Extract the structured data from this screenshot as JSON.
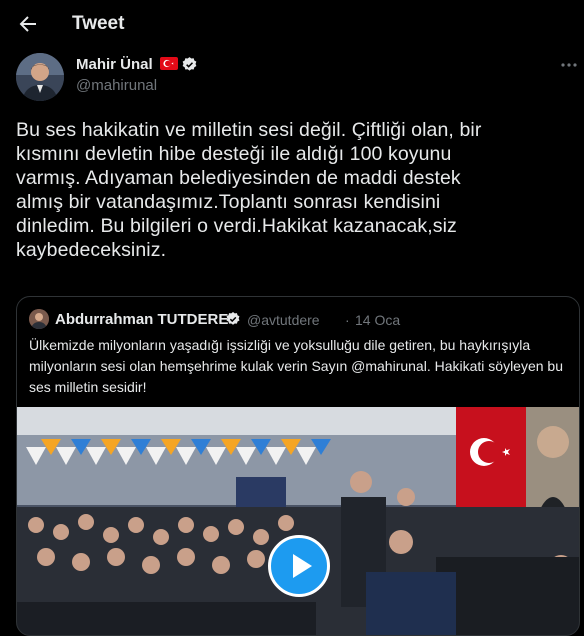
{
  "header": {
    "title": "Tweet",
    "back_icon": "arrow-left-icon"
  },
  "tweet": {
    "author_name": "Mahir Ünal",
    "handle": "@mahirunal",
    "badge_icon": "verified-icon",
    "flag_icon": "turkish-flag-icon",
    "text": "Bu ses hakikatin ve milletin sesi değil. Çiftliği olan, bir\nkısmını devletin hibe desteği ile aldığı 100 koyunu\nvarmış. Adıyaman belediyesinden de maddi destek\nalmış bir vatandaşımız.Toplantı sonrası kendisini\ndinledim. Bu bilgileri o verdi.Hakikat kazanacak,siz\nkaybedeceksiniz.",
    "more_icon": "more-icon"
  },
  "quote": {
    "author_name": "Abdurrahman TUTDERE",
    "handle": "@avtutdere",
    "dot": "·",
    "date": "14 Oca",
    "text": "Ülkemizde milyonların yaşadığı işsizliği ve yoksulluğu dile getiren, bu haykırışıyla milyonların sesi olan hemşehrime kulak verin Sayın @mahirunal. Hakikati söyleyen bu ses milletin sesidir!",
    "media_icon": "play-icon"
  },
  "colors": {
    "background": "#000000",
    "text": "#e7e9ea",
    "secondary": "#71767b",
    "accent": "#1d9bf0",
    "border": "#2f3336"
  }
}
